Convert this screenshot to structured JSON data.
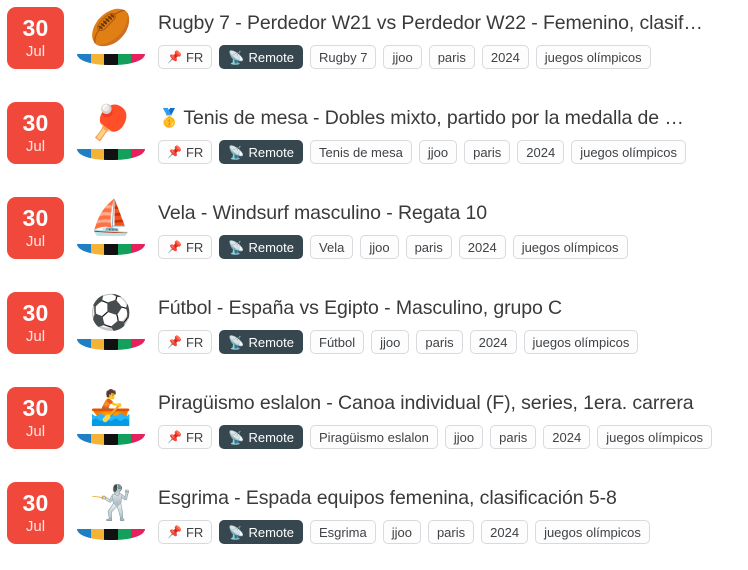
{
  "list": {
    "country_tag_label": "FR",
    "country_tag_icon": "pushpin-icon",
    "remote_tag_label": "Remote",
    "remote_tag_icon": "satellite-antenna-icon",
    "common_tags": [
      "jjoo",
      "paris",
      "2024",
      "juegos olímpicos"
    ],
    "badge_color": "#f0483a",
    "remote_color": "#36474f",
    "olympic_bar_colors": [
      "#1f7fc4",
      "#f5b335",
      "#111111",
      "#13a05a",
      "#e8205e"
    ],
    "events": [
      {
        "day": "30",
        "month": "Jul",
        "sport_emoji": "🏉",
        "sport_icon": "rugby-ball-icon",
        "medal_emoji": "",
        "title": "Rugby 7 - Perdedor W21 vs Perdedor W22 - Femenino, clasif…",
        "country": "FR",
        "remote": "Remote",
        "sport_tag": "Rugby 7",
        "tags": [
          "jjoo",
          "paris",
          "2024",
          "juegos olímpicos"
        ]
      },
      {
        "day": "30",
        "month": "Jul",
        "sport_emoji": "🏓",
        "sport_icon": "ping-pong-paddle-icon",
        "medal_emoji": "🥇",
        "title": "Tenis de mesa - Dobles mixto, partido por la medalla de …",
        "country": "FR",
        "remote": "Remote",
        "sport_tag": "Tenis de mesa",
        "tags": [
          "jjoo",
          "paris",
          "2024",
          "juegos olímpicos"
        ]
      },
      {
        "day": "30",
        "month": "Jul",
        "sport_emoji": "⛵",
        "sport_icon": "sailboat-icon",
        "medal_emoji": "",
        "title": "Vela - Windsurf masculino - Regata 10",
        "country": "FR",
        "remote": "Remote",
        "sport_tag": "Vela",
        "tags": [
          "jjoo",
          "paris",
          "2024",
          "juegos olímpicos"
        ]
      },
      {
        "day": "30",
        "month": "Jul",
        "sport_emoji": "⚽",
        "sport_icon": "soccer-ball-icon",
        "medal_emoji": "",
        "title": "Fútbol - España vs Egipto - Masculino, grupo C",
        "country": "FR",
        "remote": "Remote",
        "sport_tag": "Fútbol",
        "tags": [
          "jjoo",
          "paris",
          "2024",
          "juegos olímpicos"
        ]
      },
      {
        "day": "30",
        "month": "Jul",
        "sport_emoji": "🚣",
        "sport_icon": "rowing-canoe-icon",
        "medal_emoji": "",
        "title": "Piragüismo eslalon - Canoa individual (F), series, 1era. carrera",
        "country": "FR",
        "remote": "Remote",
        "sport_tag": "Piragüismo eslalon",
        "tags": [
          "jjoo",
          "paris",
          "2024",
          "juegos olímpicos"
        ]
      },
      {
        "day": "30",
        "month": "Jul",
        "sport_emoji": "🤺",
        "sport_icon": "fencer-icon",
        "medal_emoji": "",
        "title": "Esgrima - Espada equipos femenina, clasificación 5-8",
        "country": "FR",
        "remote": "Remote",
        "sport_tag": "Esgrima",
        "tags": [
          "jjoo",
          "paris",
          "2024",
          "juegos olímpicos"
        ]
      }
    ]
  }
}
